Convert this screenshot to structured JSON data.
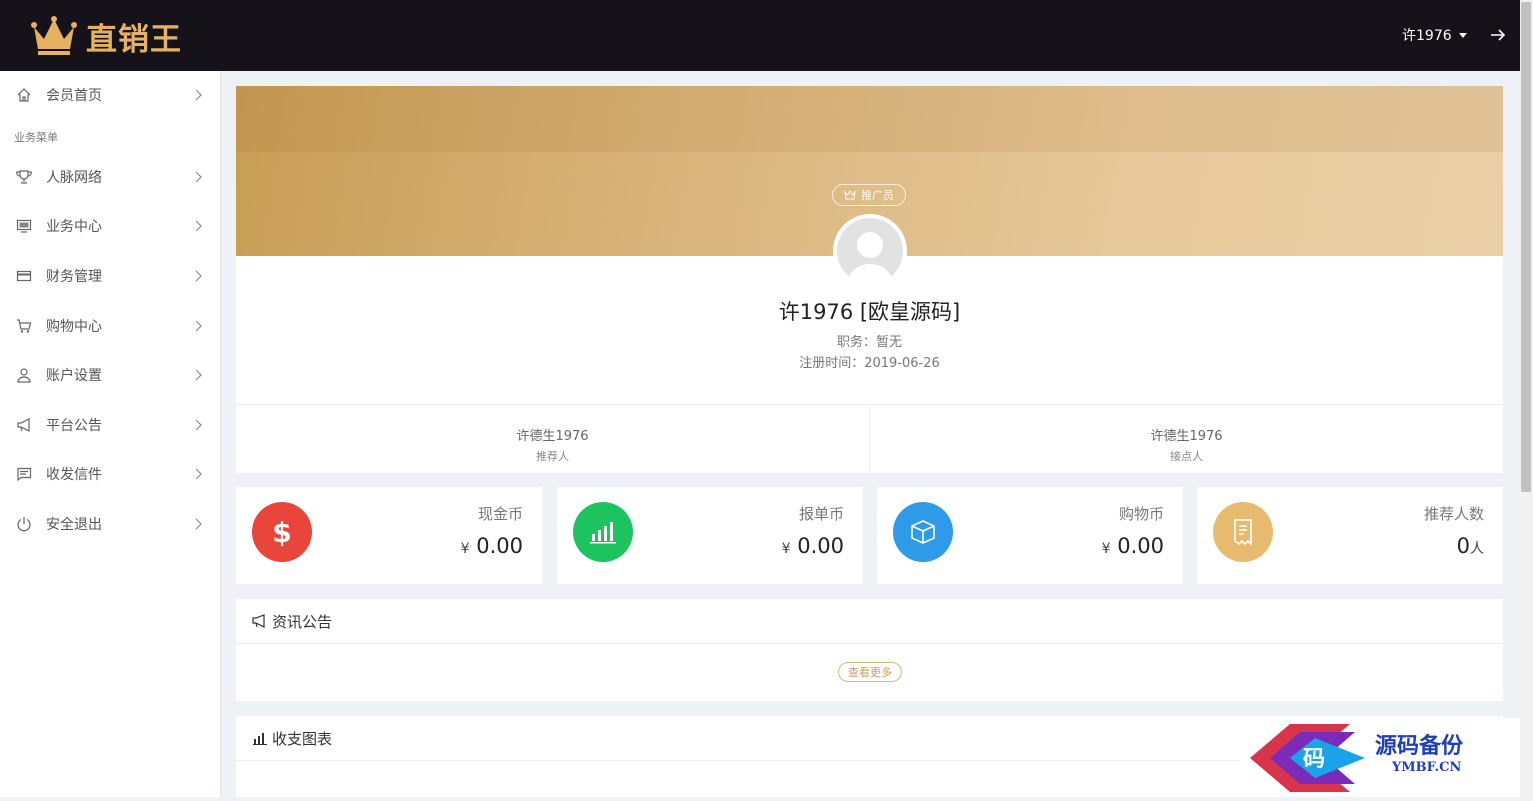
{
  "brand": {
    "name": "直销王",
    "color": "#e6b261"
  },
  "header": {
    "username": "许1976"
  },
  "sidebar": {
    "section_label": "业务菜单",
    "items": [
      {
        "label": "会员首页",
        "icon": "home-icon"
      },
      {
        "label": "人脉网络",
        "icon": "trophy-icon"
      },
      {
        "label": "业务中心",
        "icon": "monitor-icon"
      },
      {
        "label": "财务管理",
        "icon": "card-icon"
      },
      {
        "label": "购物中心",
        "icon": "cart-icon"
      },
      {
        "label": "账户设置",
        "icon": "user-icon"
      },
      {
        "label": "平台公告",
        "icon": "megaphone-icon"
      },
      {
        "label": "收发信件",
        "icon": "message-icon"
      },
      {
        "label": "安全退出",
        "icon": "power-icon"
      }
    ]
  },
  "profile": {
    "role_badge": "推广员",
    "name": "许1976 [欧皇源码]",
    "position": "职务：暂无",
    "registered": "注册时间：2019-06-26"
  },
  "relations": {
    "referrer": {
      "name": "许德生1976",
      "role": "推荐人"
    },
    "placement": {
      "name": "许德生1976",
      "role": "接点人"
    }
  },
  "stats": [
    {
      "title": "现金币",
      "prefix": "¥",
      "value": "0.00",
      "suffix": "",
      "color": "#e9453a",
      "icon": "dollar-icon"
    },
    {
      "title": "报单币",
      "prefix": "¥",
      "value": "0.00",
      "suffix": "",
      "color": "#1dc35f",
      "icon": "bar-chart-icon"
    },
    {
      "title": "购物币",
      "prefix": "¥",
      "value": "0.00",
      "suffix": "",
      "color": "#2f9be8",
      "icon": "box-icon"
    },
    {
      "title": "推荐人数",
      "prefix": "",
      "value": "0",
      "suffix": "人",
      "color": "#e6bb70",
      "icon": "receipt-icon"
    }
  ],
  "news": {
    "title": "资讯公告",
    "more_label": "查看更多"
  },
  "chart_panel": {
    "title": "收支图表"
  },
  "watermark": {
    "text": "源码备份",
    "sub": "YMBF.CN",
    "logo_char": "码"
  }
}
